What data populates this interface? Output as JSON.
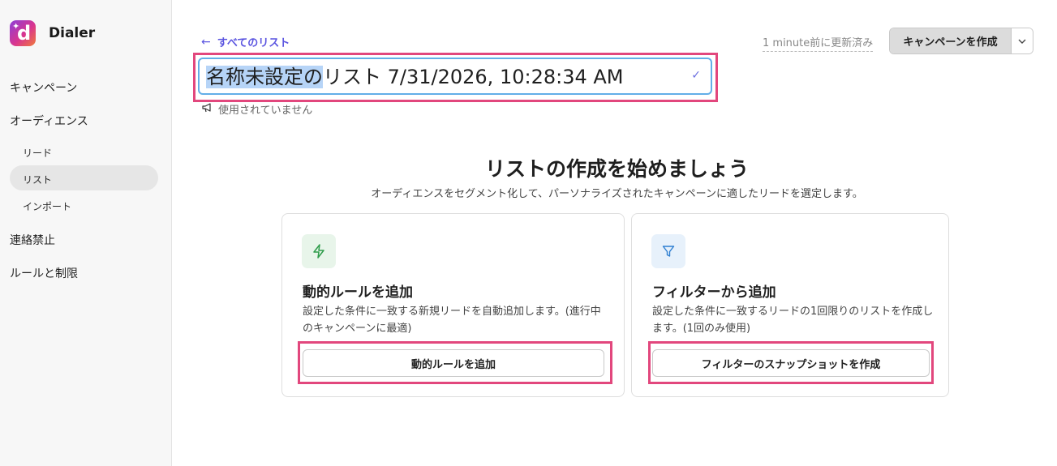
{
  "app": {
    "name": "Dialer"
  },
  "sidebar": {
    "items": [
      {
        "label": "キャンペーン"
      },
      {
        "label": "オーディエンス"
      },
      {
        "label": "リード"
      },
      {
        "label": "リスト"
      },
      {
        "label": "インポート"
      },
      {
        "label": "連絡禁止"
      },
      {
        "label": "ルールと制限"
      }
    ],
    "active": "リスト"
  },
  "header": {
    "back_label": "すべてのリスト",
    "updated_text": "1 minute前に更新済み",
    "create_campaign_label": "キャンペーンを作成"
  },
  "list_title": {
    "selected_part": "名称未設定の",
    "rest": "リスト 7/31/2026, 10:28:34 AM"
  },
  "usage_status": "使用されていません",
  "empty_state": {
    "title": "リストの作成を始めましょう",
    "subtitle": "オーディエンスをセグメント化して、パーソナライズされたキャンペーンに適したリードを選定します。"
  },
  "cards": {
    "dynamic": {
      "icon": "lightning-icon",
      "title": "動的ルールを追加",
      "desc": "設定した条件に一致する新規リードを自動追加します。(進行中のキャンペーンに最適)",
      "button": "動的ルールを追加"
    },
    "filter": {
      "icon": "funnel-icon",
      "title": "フィルターから追加",
      "desc": "設定した条件に一致するリードの1回限りのリストを作成します。(1回のみ使用)",
      "button": "フィルターのスナップショットを作成"
    }
  },
  "colors": {
    "accent": "#5b55e0",
    "highlight_frame": "#e2477d",
    "input_focus": "#62aee8",
    "dynamic_icon": "#2e9c4a",
    "filter_icon": "#2f7fd1"
  }
}
